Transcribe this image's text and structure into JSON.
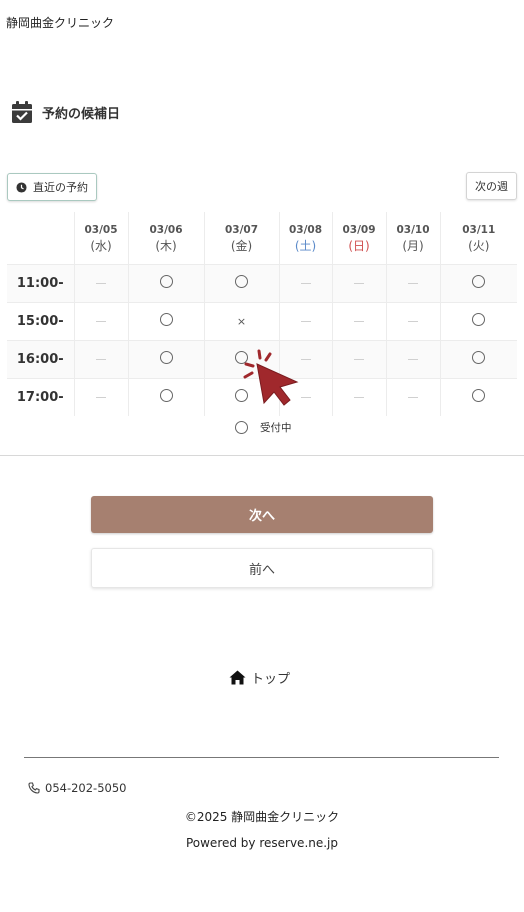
{
  "clinic_name": "静岡曲金クリニック",
  "section_title": "予約の候補日",
  "toolbar": {
    "recent_label": "直近の予約",
    "next_week_label": "次の週"
  },
  "schedule": {
    "dates": [
      {
        "date": "03/05",
        "dow": "(水)",
        "type": "weekday"
      },
      {
        "date": "03/06",
        "dow": "(木)",
        "type": "weekday"
      },
      {
        "date": "03/07",
        "dow": "(金)",
        "type": "weekday"
      },
      {
        "date": "03/08",
        "dow": "(土)",
        "type": "sat"
      },
      {
        "date": "03/09",
        "dow": "(日)",
        "type": "sun"
      },
      {
        "date": "03/10",
        "dow": "(月)",
        "type": "weekday"
      },
      {
        "date": "03/11",
        "dow": "(火)",
        "type": "weekday"
      }
    ],
    "rows": [
      {
        "time": "11:00-",
        "slots": [
          "none",
          "open",
          "open",
          "none",
          "none",
          "none",
          "open"
        ]
      },
      {
        "time": "15:00-",
        "slots": [
          "none",
          "open",
          "full",
          "none",
          "none",
          "none",
          "open"
        ]
      },
      {
        "time": "16:00-",
        "slots": [
          "none",
          "open",
          "open",
          "none",
          "none",
          "none",
          "open"
        ]
      },
      {
        "time": "17:00-",
        "slots": [
          "none",
          "open",
          "open",
          "none",
          "none",
          "none",
          "open"
        ]
      }
    ],
    "full_mark": "×"
  },
  "legend": {
    "open_label": "受付中"
  },
  "nav": {
    "next_label": "次へ",
    "prev_label": "前へ",
    "top_label": "トップ"
  },
  "footer": {
    "phone": "054-202-5050",
    "copyright": "©2025 静岡曲金クリニック",
    "powered": "Powered by reserve.ne.jp"
  },
  "colors": {
    "primary_button": "#a68070",
    "saturday": "#5b8ac9",
    "sunday": "#d05050",
    "cursor": "#a0282c"
  }
}
